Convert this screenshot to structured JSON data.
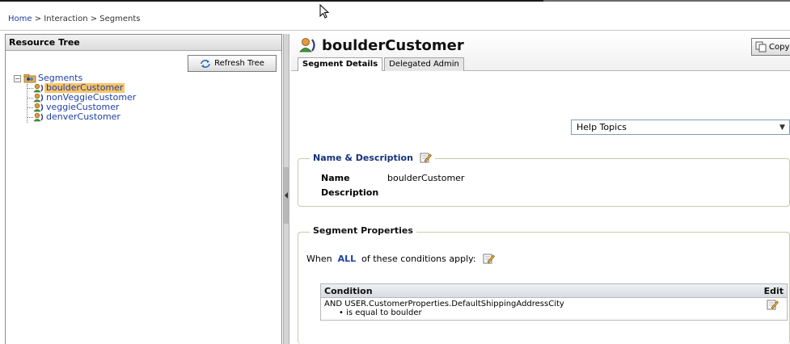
{
  "breadcrumb": {
    "home": "Home",
    "sep1": " > ",
    "interaction": "Interaction",
    "sep2": " > ",
    "current": "Segments"
  },
  "left_panel": {
    "title": "Resource Tree",
    "refresh_label": "Refresh Tree",
    "tree": {
      "root": "Segments",
      "children": [
        "boulderCustomer",
        "nonVeggieCustomer",
        "veggieCustomer",
        "denverCustomer"
      ],
      "selected": "boulderCustomer"
    }
  },
  "header": {
    "title": "boulderCustomer",
    "copy_label": "Copy",
    "tabs": [
      {
        "label": "Segment Details",
        "active": true
      },
      {
        "label": "Delegated Admin",
        "active": false
      }
    ]
  },
  "help": {
    "selected": "Help Topics"
  },
  "name_desc": {
    "legend": "Name & Description",
    "name_label": "Name",
    "name_value": "boulderCustomer",
    "description_label": "Description",
    "description_value": ""
  },
  "segment_props": {
    "legend": "Segment Properties",
    "when_prefix": "When",
    "when_mode": "ALL",
    "when_suffix": "of these conditions apply:",
    "table": {
      "col_condition": "Condition",
      "col_edit": "Edit",
      "rows": [
        {
          "line1": "AND  USER.CustomerProperties.DefaultShippingAddressCity",
          "line2": "is equal to  boulder"
        }
      ]
    }
  },
  "colors": {
    "link": "#1f3fa3",
    "selected_bg": "#f9c468",
    "legend_blue": "#13337a"
  }
}
